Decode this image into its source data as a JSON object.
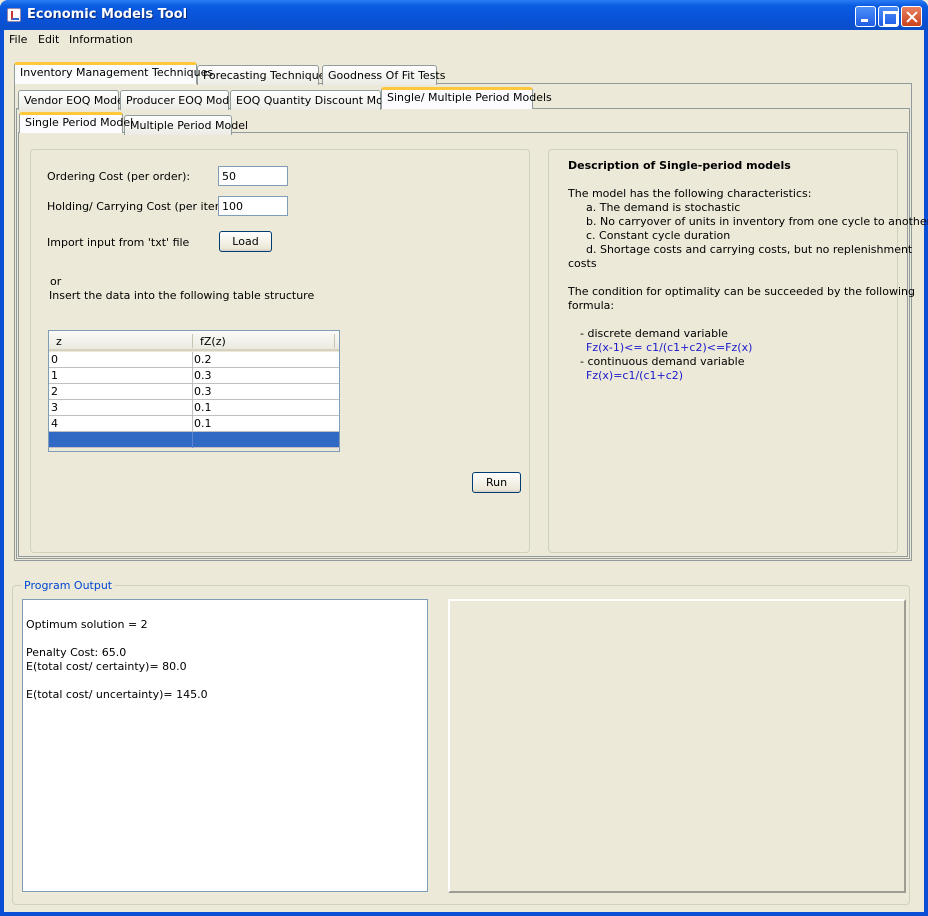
{
  "window": {
    "title": "Economic Models Tool"
  },
  "menu": [
    "File",
    "Edit",
    "Information"
  ],
  "main_tabs": [
    "Inventory Management Techniques",
    "Forecasting Techniques",
    "Goodness Of Fit Tests"
  ],
  "inventory_tabs": [
    "Vendor EOQ Model",
    "Producer EOQ Model",
    "EOQ Quantity Discount Model",
    "Single/ Multiple Period Models"
  ],
  "period_tabs": [
    "Single Period Model",
    "Multiple Period Model"
  ],
  "form": {
    "ordering_cost_label": "Ordering Cost  (per order):",
    "ordering_cost_value": "50",
    "holding_cost_label": "Holding/ Carrying Cost (per item):",
    "holding_cost_value": "100",
    "import_label": "Import input from 'txt' file",
    "load_button": "Load",
    "or_text": "or",
    "insert_text": "Insert the data into the following table structure",
    "run_button": "Run"
  },
  "table": {
    "headers": [
      "z",
      "fZ(z)"
    ],
    "rows": [
      [
        "0",
        "0.2"
      ],
      [
        "1",
        "0.3"
      ],
      [
        "2",
        "0.3"
      ],
      [
        "3",
        "0.1"
      ],
      [
        "4",
        "0.1"
      ]
    ]
  },
  "description": {
    "title": "Description of Single-period models",
    "intro": "The model has the following characteristics:",
    "items": [
      "a. The demand is stochastic",
      "b. No carryover of units in inventory from one cycle to another",
      "c. Constant cycle duration",
      "d. Shortage costs and carrying costs, but no replenishment"
    ],
    "item_d_cont": "costs",
    "condition_1": "The condition for optimality can be succeeded by the following",
    "condition_2": "formula:",
    "discrete_label": "- discrete demand variable",
    "discrete_formula": "Fz(x-1)<= c1/(c1+c2)<=Fz(x)",
    "continuous_label": "- continuous demand variable",
    "continuous_formula": "Fz(x)=c1/(c1+c2)"
  },
  "output": {
    "title": "Program Output",
    "lines": [
      "Optimum solution = 2",
      "Penalty Cost: 65.0",
      "E(total cost/ certainty)= 80.0",
      "E(total cost/ uncertainty)=  145.0"
    ]
  },
  "colors": {
    "title_bar": "#0a5ce0",
    "active_tab_accent": "#ffc83c",
    "formula": "#1a1acc",
    "selection": "#316ac5",
    "group_title": "#0046d5"
  }
}
